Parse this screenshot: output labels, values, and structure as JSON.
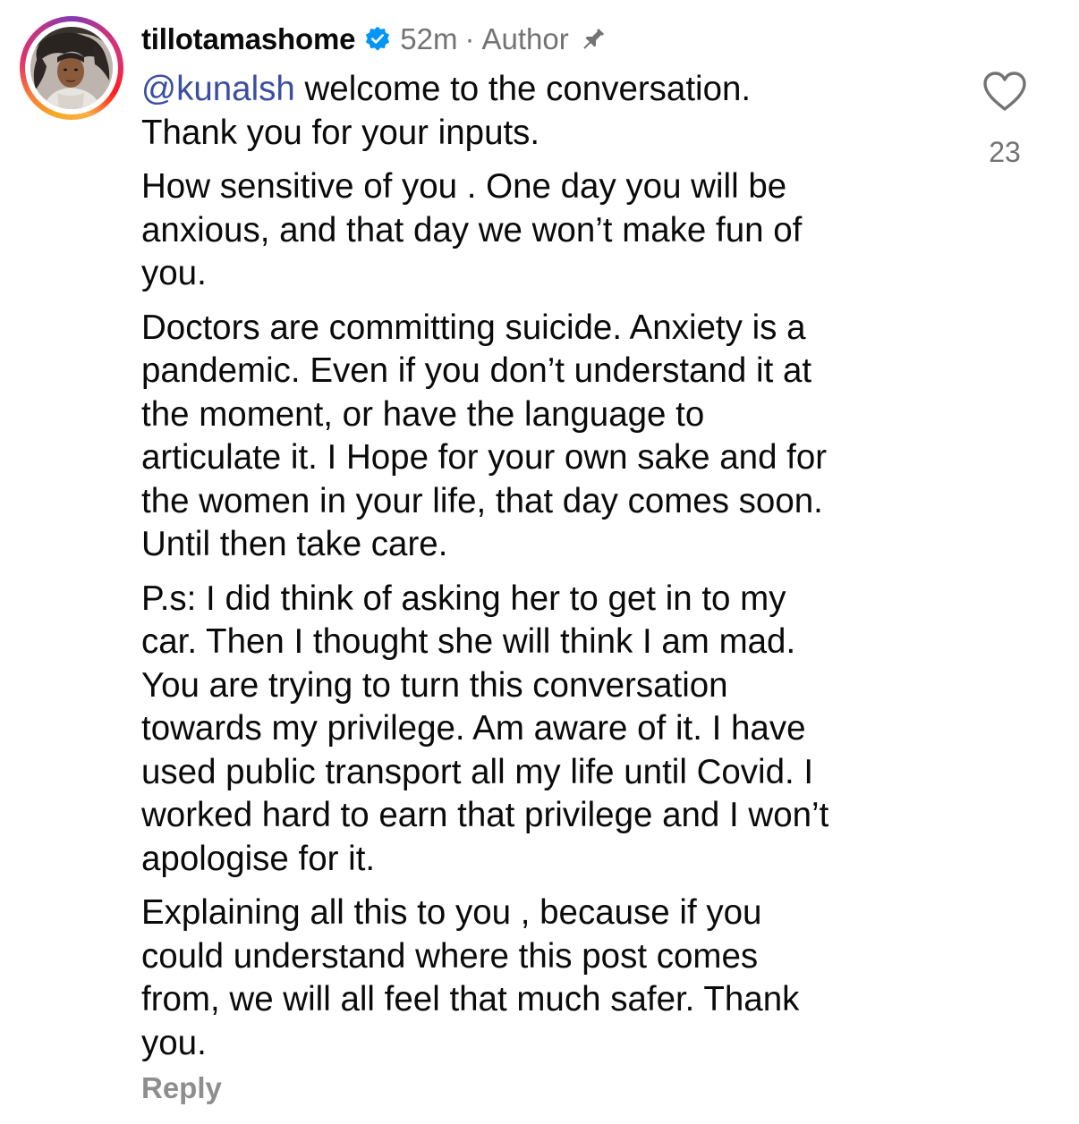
{
  "comment": {
    "username": "tillotamashome",
    "time": "52m",
    "separator": "·",
    "role": "Author",
    "verified_icon": "verified-badge-icon",
    "pin_icon": "pin-icon",
    "mention": "@kunalsh",
    "paragraphs": [
      [
        " welcome to the conversation.",
        "Thank you for your inputs."
      ],
      [
        "How sensitive of you . One day you will be",
        "anxious, and that day we won’t make fun of",
        "you."
      ],
      [
        "Doctors are committing suicide. Anxiety is a",
        "pandemic. Even if you don’t understand it at",
        "the moment, or have the language to",
        "articulate it. I Hope for your own sake and for",
        "the women in your life, that day comes soon.",
        "Until then take care."
      ],
      [
        "P.s: I did think of asking her to get in to my",
        "car. Then I thought she will think I am mad.",
        "You are trying to turn this conversation",
        "towards my privilege. Am aware of it. I have",
        "used public transport all my life until Covid. I",
        "worked hard to earn that privilege and I won’t",
        "apologise for it."
      ],
      [
        "Explaining all this to you , because if you",
        "could understand where this post comes",
        "from, we will all feel that much safer. Thank",
        "you."
      ]
    ],
    "reply_label": "Reply",
    "like_icon": "heart-outline-icon",
    "like_count": "23",
    "colors": {
      "mention": "#3b4ea0",
      "muted": "#737373",
      "verified": "#0095f6"
    }
  }
}
